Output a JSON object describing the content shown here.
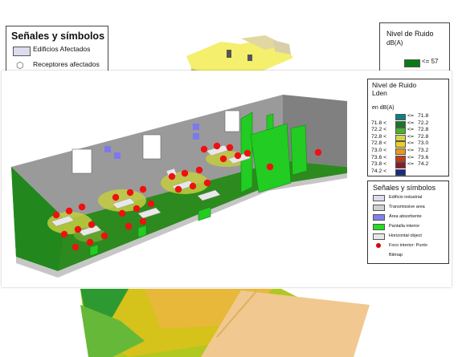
{
  "background": {
    "legend_title": "Señales y símbolos",
    "items": [
      "Edificios Afectados",
      "Receptores afectados"
    ],
    "noise_title": "Nivel de Ruido",
    "noise_unit": "dB(A)",
    "noise_row": "<=  57"
  },
  "noise_legend": {
    "title_line1": "Nivel de Ruido",
    "title_line2": "Lden",
    "unit": "en dB(A)",
    "rows": [
      {
        "lo": "",
        "le": "<=",
        "hi": "71.8",
        "color": "#0f7f7f"
      },
      {
        "lo": "71.8 <",
        "le": "<=",
        "hi": "72.2",
        "color": "#137b20"
      },
      {
        "lo": "72.2 <",
        "le": "<=",
        "hi": "72.8",
        "color": "#46b42e"
      },
      {
        "lo": "72.8 <",
        "le": "<=",
        "hi": "72.8",
        "color": "#d7d54a"
      },
      {
        "lo": "72.8 <",
        "le": "<=",
        "hi": "73.0",
        "color": "#ecd021"
      },
      {
        "lo": "73.0 <",
        "le": "<=",
        "hi": "73.2",
        "color": "#e69a1a"
      },
      {
        "lo": "73.6 <",
        "le": "<=",
        "hi": "73.6",
        "color": "#c23a16"
      },
      {
        "lo": "73.8 <",
        "le": "<=",
        "hi": "74.2",
        "color": "#8a1b2a"
      },
      {
        "lo": "74.2 <",
        "le": "",
        "hi": "",
        "color": "#1a2a80"
      }
    ]
  },
  "symbols_legend": {
    "title": "Señales y símbolos",
    "items": [
      {
        "label": "Edificio industrial",
        "type": "box",
        "color": "#dcdcee"
      },
      {
        "label": "Transmissive area",
        "type": "box",
        "color": "#d0d0d0"
      },
      {
        "label": "Área absorbente",
        "type": "box",
        "color": "#8080ee"
      },
      {
        "label": "Pantalla interior",
        "type": "box",
        "color": "#22dd22"
      },
      {
        "label": "Horizontal object",
        "type": "box",
        "color": "#e8e8e8"
      },
      {
        "label": "Foco interior: Punto",
        "type": "dot",
        "color": "#e00000"
      },
      {
        "label": "Bitmap",
        "type": "none",
        "color": ""
      }
    ]
  }
}
